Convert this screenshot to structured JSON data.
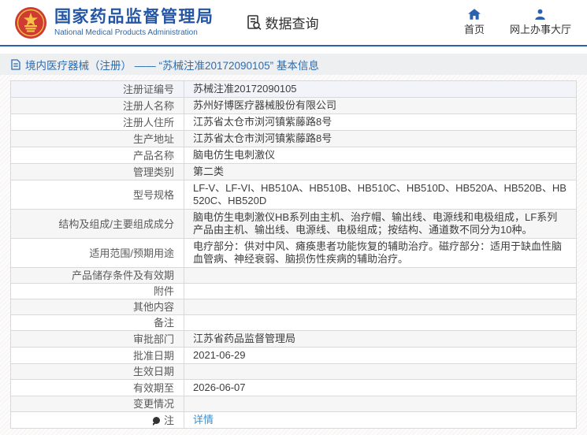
{
  "header": {
    "site_title": "国家药品监督管理局",
    "site_subtitle": "National Medical Products Administration",
    "logo_icon": "national-emblem-icon",
    "section_title": "数据查询",
    "section_icon": "data-query-icon",
    "nav": [
      {
        "label": "首页",
        "icon": "home-icon"
      },
      {
        "label": "网上办事大厅",
        "icon": "user-icon"
      }
    ]
  },
  "breadcrumb": {
    "icon": "document-icon",
    "text": "境内医疗器械（注册） —— “苏械注准20172090105” 基本信息"
  },
  "table": {
    "rows": [
      {
        "label": "注册证编号",
        "value": "苏械注准20172090105"
      },
      {
        "label": "注册人名称",
        "value": "苏州好博医疗器械股份有限公司"
      },
      {
        "label": "注册人住所",
        "value": "江苏省太仓市浏河镇紫藤路8号"
      },
      {
        "label": "生产地址",
        "value": "江苏省太仓市浏河镇紫藤路8号"
      },
      {
        "label": "产品名称",
        "value": "脑电仿生电刺激仪"
      },
      {
        "label": "管理类别",
        "value": "第二类"
      },
      {
        "label": "型号规格",
        "value": "LF-V、LF-VI、HB510A、HB510B、HB510C、HB510D、HB520A、HB520B、HB520C、HB520D"
      },
      {
        "label": "结构及组成/主要组成成分",
        "value": "脑电仿生电刺激仪HB系列由主机、治疗帽、输出线、电源线和电极组成，LF系列产品由主机、输出线、电源线、电极组成；按结构、通道数不同分为10种。"
      },
      {
        "label": "适用范围/预期用途",
        "value": "电疗部分：供对中风、瘫痪患者功能恢复的辅助治疗。磁疗部分：适用于缺血性脑血管病、神经衰弱、脑损伤性疾病的辅助治疗。"
      },
      {
        "label": "产品储存条件及有效期",
        "value": ""
      },
      {
        "label": "附件",
        "value": ""
      },
      {
        "label": "其他内容",
        "value": ""
      },
      {
        "label": "备注",
        "value": ""
      },
      {
        "label": "审批部门",
        "value": "江苏省药品监督管理局"
      },
      {
        "label": "批准日期",
        "value": "2021-06-29"
      },
      {
        "label": "生效日期",
        "value": ""
      },
      {
        "label": "有效期至",
        "value": "2026-06-07"
      },
      {
        "label": "变更情况",
        "value": ""
      },
      {
        "label": "注",
        "label_icon": "note-icon",
        "value": "详情",
        "link": true
      }
    ]
  },
  "colors": {
    "brand_blue": "#2456a4",
    "header_border_blue": "#2a64a8",
    "breadcrumb_blue": "#2c6db2",
    "link_blue": "#3e8ece",
    "emblem_red": "#cf3a32",
    "emblem_gold": "#f3c247",
    "row_gray": "#f6f6f6",
    "row_first": "#f2f4f9",
    "table_border": "#d9d9d9"
  }
}
